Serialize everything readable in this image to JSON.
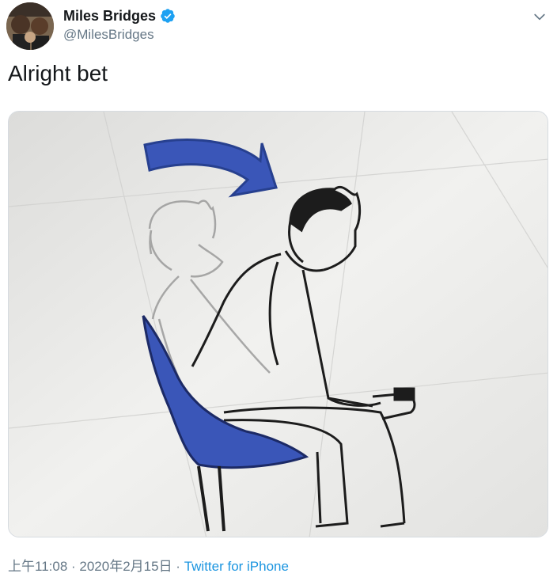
{
  "tweet": {
    "display_name": "Miles Bridges",
    "handle": "@MilesBridges",
    "verified": true,
    "text": "Alright bet",
    "time": "上午11:08",
    "separator": " · ",
    "date": "2020年2月15日",
    "source": "Twitter for iPhone"
  },
  "icons": {
    "verified": "verified-badge-icon",
    "menu": "chevron-down-icon"
  },
  "colors": {
    "link": "#1b95e0",
    "muted": "#657786",
    "verified": "#1da1f2",
    "chair_blue": "#3a56b8"
  }
}
